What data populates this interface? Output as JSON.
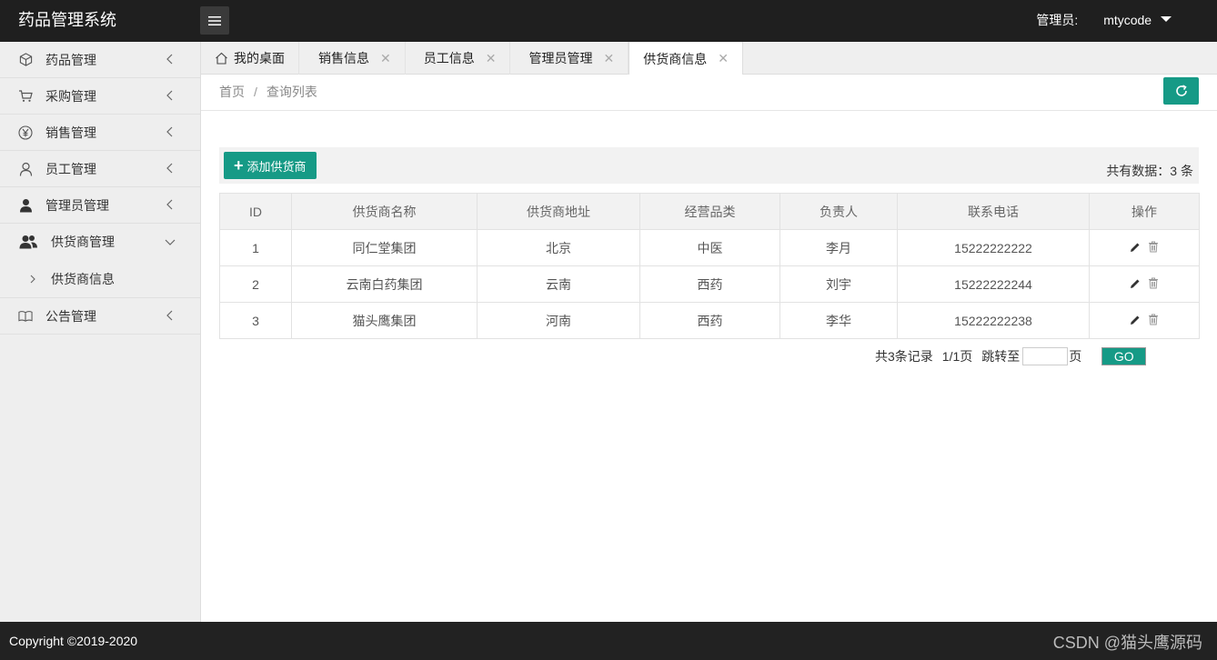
{
  "header": {
    "app_title": "药品管理系统",
    "role_label": "管理员:",
    "username": "mtycode"
  },
  "sidebar": {
    "items": [
      {
        "label": "药品管理",
        "icon": "cube-icon"
      },
      {
        "label": "采购管理",
        "icon": "cart-icon"
      },
      {
        "label": "销售管理",
        "icon": "yen-icon"
      },
      {
        "label": "员工管理",
        "icon": "user-outline-icon"
      },
      {
        "label": "管理员管理",
        "icon": "user-solid-icon"
      },
      {
        "label": "供货商管理",
        "icon": "users-icon",
        "expanded": true,
        "children": [
          "供货商信息"
        ]
      },
      {
        "label": "公告管理",
        "icon": "book-icon"
      }
    ]
  },
  "tabs": [
    {
      "label": "我的桌面",
      "home": true
    },
    {
      "label": "销售信息",
      "close": "✕"
    },
    {
      "label": "员工信息",
      "close": "✕"
    },
    {
      "label": "管理员管理",
      "close": "✕"
    },
    {
      "label": "供货商信息",
      "close": "✕",
      "active": true
    }
  ],
  "breadcrumb": {
    "home": "首页",
    "sep": "/",
    "current": "查询列表"
  },
  "toolbar": {
    "add_label": "添加供货商",
    "total_text": "共有数据：3 条"
  },
  "table": {
    "columns": [
      "ID",
      "供货商名称",
      "供货商地址",
      "经营品类",
      "负责人",
      "联系电话",
      "操作"
    ],
    "rows": [
      [
        "1",
        "同仁堂集团",
        "北京",
        "中医",
        "李月",
        "15222222222"
      ],
      [
        "2",
        "云南白药集团",
        "云南",
        "西药",
        "刘宇",
        "15222222244"
      ],
      [
        "3",
        "猫头鹰集团",
        "河南",
        "西药",
        "李华",
        "15222222238"
      ]
    ]
  },
  "pager": {
    "records": "共3条记录",
    "pages": "1/1页",
    "jump_label": "跳转至",
    "page_unit": "页",
    "go": "GO",
    "jump_value": ""
  },
  "footer": {
    "copyright": "Copyright ©2019-2020",
    "watermark": "CSDN @猫头鹰源码"
  },
  "colors": {
    "accent": "#169a86",
    "header_bg": "#1f1f1f",
    "sidebar_bg": "#eeeeee"
  }
}
